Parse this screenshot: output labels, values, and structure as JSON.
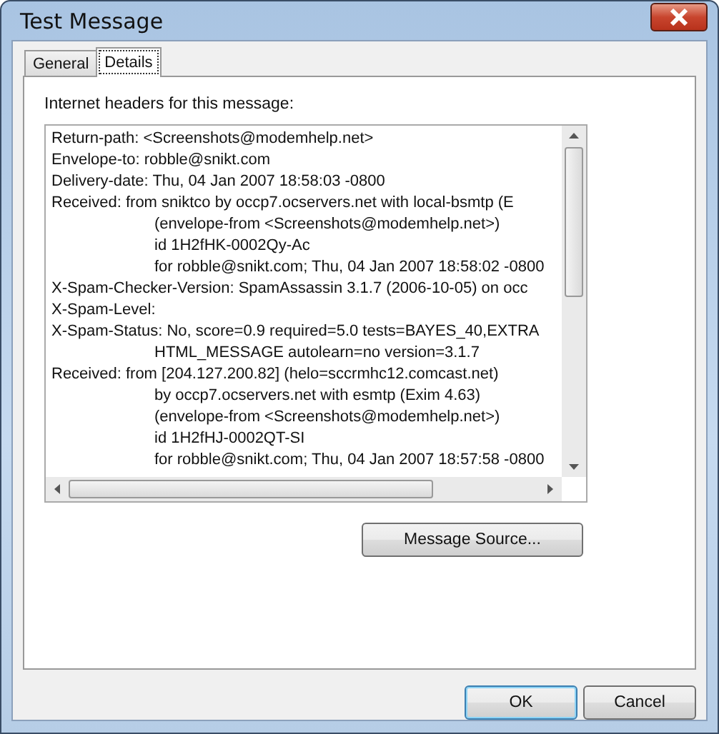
{
  "window": {
    "title": "Test Message"
  },
  "tabs": [
    {
      "label": "General",
      "selected": false
    },
    {
      "label": "Details",
      "selected": true
    }
  ],
  "details": {
    "label": "Internet headers for this message:",
    "header_lines": [
      {
        "kind": "header",
        "text": "Return-path: <Screenshots@modemhelp.net>"
      },
      {
        "kind": "header",
        "text": "Envelope-to: robble@snikt.com"
      },
      {
        "kind": "header",
        "text": "Delivery-date: Thu, 04 Jan 2007 18:58:03 -0800"
      },
      {
        "kind": "header",
        "text": "Received: from sniktco by occp7.ocservers.net with local-bsmtp (E"
      },
      {
        "kind": "continuation",
        "text": "(envelope-from <Screenshots@modemhelp.net>)"
      },
      {
        "kind": "continuation",
        "text": "id 1H2fHK-0002Qy-Ac"
      },
      {
        "kind": "continuation",
        "text": "for robble@snikt.com; Thu, 04 Jan 2007 18:58:02 -0800"
      },
      {
        "kind": "header",
        "text": "X-Spam-Checker-Version: SpamAssassin 3.1.7 (2006-10-05) on occ"
      },
      {
        "kind": "header",
        "text": "X-Spam-Level:"
      },
      {
        "kind": "header",
        "text": "X-Spam-Status: No, score=0.9 required=5.0 tests=BAYES_40,EXTRA"
      },
      {
        "kind": "continuation",
        "text": "HTML_MESSAGE autolearn=no version=3.1.7"
      },
      {
        "kind": "header",
        "text": "Received: from [204.127.200.82] (helo=sccrmhc12.comcast.net)"
      },
      {
        "kind": "continuation",
        "text": "by occp7.ocservers.net with esmtp (Exim 4.63)"
      },
      {
        "kind": "continuation",
        "text": "(envelope-from <Screenshots@modemhelp.net>)"
      },
      {
        "kind": "continuation",
        "text": "id 1H2fHJ-0002QT-SI"
      },
      {
        "kind": "continuation",
        "text": "for robble@snikt.com; Thu, 04 Jan 2007 18:57:58 -0800"
      }
    ],
    "source_button": "Message Source..."
  },
  "buttons": [
    {
      "label": "OK",
      "default": true
    },
    {
      "label": "Cancel",
      "default": false
    }
  ]
}
